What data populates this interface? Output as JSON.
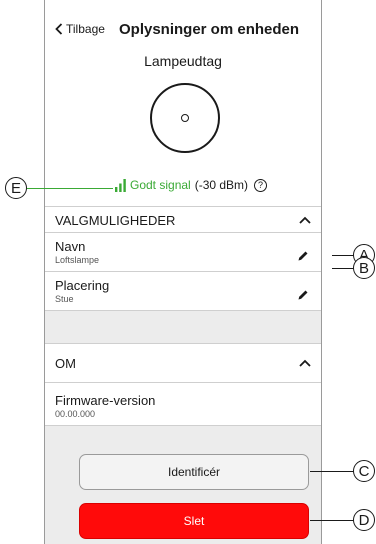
{
  "header": {
    "back_label": "Tilbage",
    "title": "Oplysninger om enheden"
  },
  "device": {
    "name": "Lampeudtag"
  },
  "signal": {
    "quality": "Godt signal",
    "strength": "(-30 dBm)",
    "help": "?"
  },
  "options_section": {
    "title": "VALGMULIGHEDER",
    "rows": [
      {
        "label": "Navn",
        "value": "Loftslampe"
      },
      {
        "label": "Placering",
        "value": "Stue"
      }
    ]
  },
  "about_section": {
    "title": "OM",
    "rows": [
      {
        "label": "Firmware-version",
        "value": "00.00.000"
      }
    ]
  },
  "buttons": {
    "identify": "Identificér",
    "delete": "Slet"
  },
  "callouts": {
    "a": "A",
    "b": "B",
    "c": "C",
    "d": "D",
    "e": "E"
  },
  "colors": {
    "accent_green": "#3aaa35",
    "delete_red": "#ff0a0a"
  }
}
